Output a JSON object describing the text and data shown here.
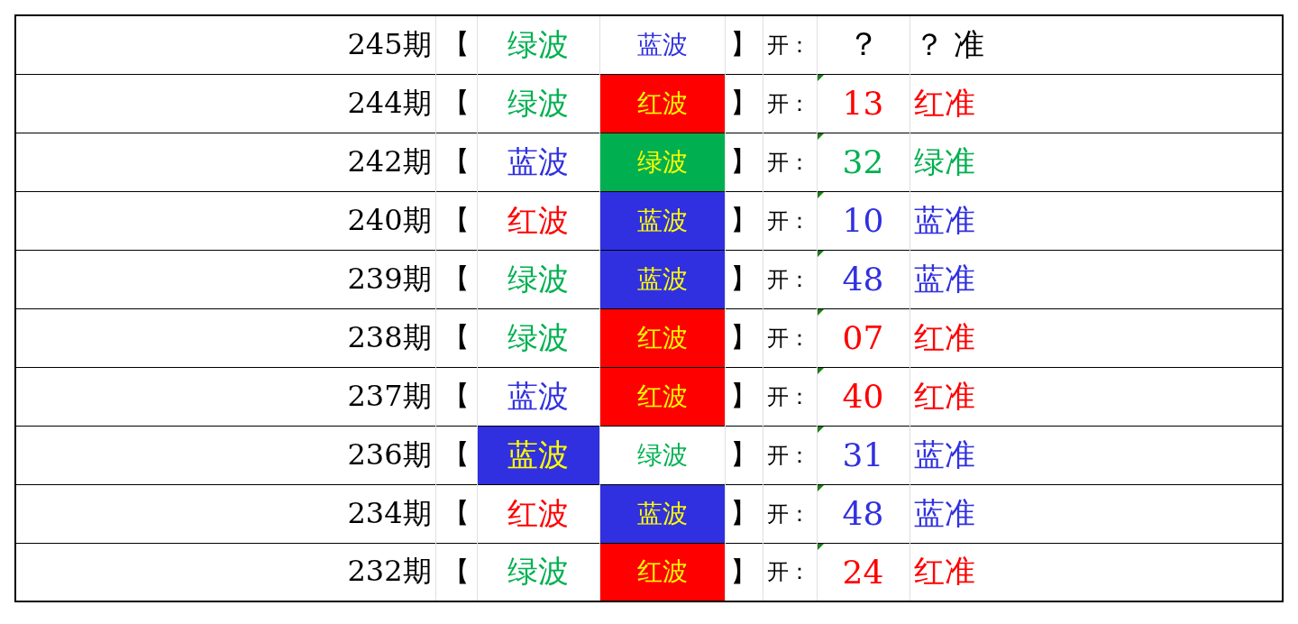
{
  "rows": [
    {
      "period": "245期",
      "open_bracket": "【",
      "wave_1": {
        "text": "绿波",
        "color": "#00b050"
      },
      "wave_2": {
        "text": "蓝波",
        "color": "#3030e0"
      },
      "close_bracket": "】",
      "open_label": "开：",
      "number": {
        "text": "？",
        "color": "#000000",
        "flagged": false
      },
      "result": {
        "text": "？ 准",
        "color": "#000000"
      }
    },
    {
      "period": "244期",
      "open_bracket": "【",
      "wave_1": {
        "text": "绿波",
        "color": "#00b050"
      },
      "wave_2": {
        "text": "红波",
        "color": "#ffff00",
        "highlight": {
          "color": "#ff0000"
        }
      },
      "close_bracket": "】",
      "open_label": "开：",
      "number": {
        "text": "13",
        "color": "#ff0000",
        "flagged": true
      },
      "result": {
        "text": "红准",
        "color": "#ff0000"
      }
    },
    {
      "period": "242期",
      "open_bracket": "【",
      "wave_1": {
        "text": "蓝波",
        "color": "#3030e0"
      },
      "wave_2": {
        "text": "绿波",
        "color": "#ffff00",
        "highlight": {
          "color": "#00b050"
        }
      },
      "close_bracket": "】",
      "open_label": "开：",
      "number": {
        "text": "32",
        "color": "#00b050",
        "flagged": true
      },
      "result": {
        "text": "绿准",
        "color": "#00b050"
      }
    },
    {
      "period": "240期",
      "open_bracket": "【",
      "wave_1": {
        "text": "红波",
        "color": "#ff0000"
      },
      "wave_2": {
        "text": "蓝波",
        "color": "#ffff00",
        "highlight": {
          "color": "#3030e0"
        }
      },
      "close_bracket": "】",
      "open_label": "开：",
      "number": {
        "text": "10",
        "color": "#3030e0",
        "flagged": true
      },
      "result": {
        "text": "蓝准",
        "color": "#3030e0"
      }
    },
    {
      "period": "239期",
      "open_bracket": "【",
      "wave_1": {
        "text": "绿波",
        "color": "#00b050"
      },
      "wave_2": {
        "text": "蓝波",
        "color": "#ffff00",
        "highlight": {
          "color": "#3030e0"
        }
      },
      "close_bracket": "】",
      "open_label": "开：",
      "number": {
        "text": "48",
        "color": "#3030e0",
        "flagged": true
      },
      "result": {
        "text": "蓝准",
        "color": "#3030e0"
      }
    },
    {
      "period": "238期",
      "open_bracket": "【",
      "wave_1": {
        "text": "绿波",
        "color": "#00b050"
      },
      "wave_2": {
        "text": "红波",
        "color": "#ffff00",
        "highlight": {
          "color": "#ff0000"
        }
      },
      "close_bracket": "】",
      "open_label": "开：",
      "number": {
        "text": "07",
        "color": "#ff0000",
        "flagged": true
      },
      "result": {
        "text": "红准",
        "color": "#ff0000"
      }
    },
    {
      "period": "237期",
      "open_bracket": "【",
      "wave_1": {
        "text": "蓝波",
        "color": "#3030e0"
      },
      "wave_2": {
        "text": "红波",
        "color": "#ffff00",
        "highlight": {
          "color": "#ff0000"
        }
      },
      "close_bracket": "】",
      "open_label": "开：",
      "number": {
        "text": "40",
        "color": "#ff0000",
        "flagged": true
      },
      "result": {
        "text": "红准",
        "color": "#ff0000"
      }
    },
    {
      "period": "236期",
      "open_bracket": "【",
      "wave_1": {
        "text": "蓝波",
        "color": "#ffff00",
        "highlight": {
          "color": "#3030e0"
        }
      },
      "wave_2": {
        "text": "绿波",
        "color": "#00b050"
      },
      "close_bracket": "】",
      "open_label": "开：",
      "number": {
        "text": "31",
        "color": "#3030e0",
        "flagged": true
      },
      "result": {
        "text": "蓝准",
        "color": "#3030e0"
      }
    },
    {
      "period": "234期",
      "open_bracket": "【",
      "wave_1": {
        "text": "红波",
        "color": "#ff0000"
      },
      "wave_2": {
        "text": "蓝波",
        "color": "#ffff00",
        "highlight": {
          "color": "#3030e0"
        }
      },
      "close_bracket": "】",
      "open_label": "开：",
      "number": {
        "text": "48",
        "color": "#3030e0",
        "flagged": true
      },
      "result": {
        "text": "蓝准",
        "color": "#3030e0"
      }
    },
    {
      "period": "232期",
      "open_bracket": "【",
      "wave_1": {
        "text": "绿波",
        "color": "#00b050"
      },
      "wave_2": {
        "text": "红波",
        "color": "#ffff00",
        "highlight": {
          "color": "#ff0000"
        }
      },
      "close_bracket": "】",
      "open_label": "开：",
      "number": {
        "text": "24",
        "color": "#ff0000",
        "flagged": true
      },
      "result": {
        "text": "红准",
        "color": "#ff0000"
      }
    }
  ]
}
